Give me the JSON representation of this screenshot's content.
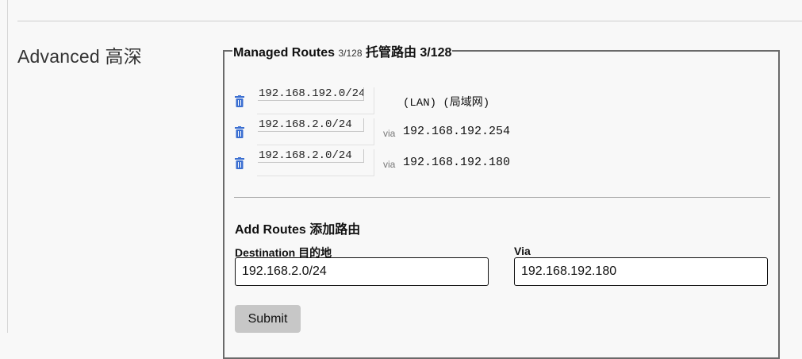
{
  "section": {
    "title": "Advanced 高深"
  },
  "managed": {
    "legend_main": "Managed Routes ",
    "legend_small": "3/128",
    "legend_zh": " 托管路由 3/128"
  },
  "routes": [
    {
      "destination": "192.168.192.0/24",
      "note": "(LAN) (局域网)"
    },
    {
      "destination": "192.168.2.0/24",
      "via_label": "via",
      "via": "192.168.192.254"
    },
    {
      "destination": "192.168.2.0/24",
      "via_label": "via",
      "via": "192.168.192.180"
    }
  ],
  "icons": {
    "delete": "trash-icon",
    "accent": "#3b6fd1"
  },
  "add": {
    "title": "Add Routes 添加路由",
    "destination_label": "Destination 目的地",
    "destination_value": "192.168.2.0/24",
    "via_label": "Via",
    "via_value": "192.168.192.180",
    "submit_label": "Submit"
  }
}
